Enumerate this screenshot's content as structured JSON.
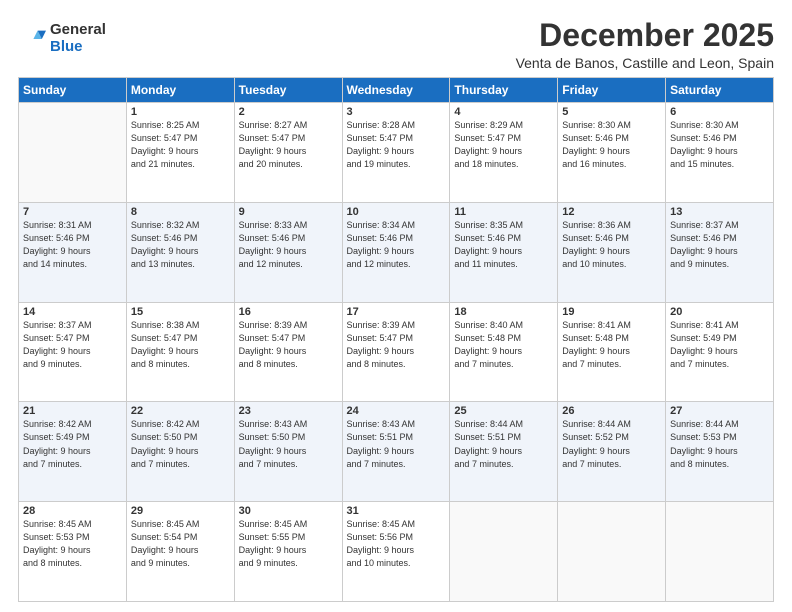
{
  "logo": {
    "general": "General",
    "blue": "Blue"
  },
  "header": {
    "month": "December 2025",
    "location": "Venta de Banos, Castille and Leon, Spain"
  },
  "weekdays": [
    "Sunday",
    "Monday",
    "Tuesday",
    "Wednesday",
    "Thursday",
    "Friday",
    "Saturday"
  ],
  "weeks": [
    [
      {
        "day": "",
        "info": ""
      },
      {
        "day": "1",
        "info": "Sunrise: 8:25 AM\nSunset: 5:47 PM\nDaylight: 9 hours\nand 21 minutes."
      },
      {
        "day": "2",
        "info": "Sunrise: 8:27 AM\nSunset: 5:47 PM\nDaylight: 9 hours\nand 20 minutes."
      },
      {
        "day": "3",
        "info": "Sunrise: 8:28 AM\nSunset: 5:47 PM\nDaylight: 9 hours\nand 19 minutes."
      },
      {
        "day": "4",
        "info": "Sunrise: 8:29 AM\nSunset: 5:47 PM\nDaylight: 9 hours\nand 18 minutes."
      },
      {
        "day": "5",
        "info": "Sunrise: 8:30 AM\nSunset: 5:46 PM\nDaylight: 9 hours\nand 16 minutes."
      },
      {
        "day": "6",
        "info": "Sunrise: 8:30 AM\nSunset: 5:46 PM\nDaylight: 9 hours\nand 15 minutes."
      }
    ],
    [
      {
        "day": "7",
        "info": "Sunrise: 8:31 AM\nSunset: 5:46 PM\nDaylight: 9 hours\nand 14 minutes."
      },
      {
        "day": "8",
        "info": "Sunrise: 8:32 AM\nSunset: 5:46 PM\nDaylight: 9 hours\nand 13 minutes."
      },
      {
        "day": "9",
        "info": "Sunrise: 8:33 AM\nSunset: 5:46 PM\nDaylight: 9 hours\nand 12 minutes."
      },
      {
        "day": "10",
        "info": "Sunrise: 8:34 AM\nSunset: 5:46 PM\nDaylight: 9 hours\nand 12 minutes."
      },
      {
        "day": "11",
        "info": "Sunrise: 8:35 AM\nSunset: 5:46 PM\nDaylight: 9 hours\nand 11 minutes."
      },
      {
        "day": "12",
        "info": "Sunrise: 8:36 AM\nSunset: 5:46 PM\nDaylight: 9 hours\nand 10 minutes."
      },
      {
        "day": "13",
        "info": "Sunrise: 8:37 AM\nSunset: 5:46 PM\nDaylight: 9 hours\nand 9 minutes."
      }
    ],
    [
      {
        "day": "14",
        "info": "Sunrise: 8:37 AM\nSunset: 5:47 PM\nDaylight: 9 hours\nand 9 minutes."
      },
      {
        "day": "15",
        "info": "Sunrise: 8:38 AM\nSunset: 5:47 PM\nDaylight: 9 hours\nand 8 minutes."
      },
      {
        "day": "16",
        "info": "Sunrise: 8:39 AM\nSunset: 5:47 PM\nDaylight: 9 hours\nand 8 minutes."
      },
      {
        "day": "17",
        "info": "Sunrise: 8:39 AM\nSunset: 5:47 PM\nDaylight: 9 hours\nand 8 minutes."
      },
      {
        "day": "18",
        "info": "Sunrise: 8:40 AM\nSunset: 5:48 PM\nDaylight: 9 hours\nand 7 minutes."
      },
      {
        "day": "19",
        "info": "Sunrise: 8:41 AM\nSunset: 5:48 PM\nDaylight: 9 hours\nand 7 minutes."
      },
      {
        "day": "20",
        "info": "Sunrise: 8:41 AM\nSunset: 5:49 PM\nDaylight: 9 hours\nand 7 minutes."
      }
    ],
    [
      {
        "day": "21",
        "info": "Sunrise: 8:42 AM\nSunset: 5:49 PM\nDaylight: 9 hours\nand 7 minutes."
      },
      {
        "day": "22",
        "info": "Sunrise: 8:42 AM\nSunset: 5:50 PM\nDaylight: 9 hours\nand 7 minutes."
      },
      {
        "day": "23",
        "info": "Sunrise: 8:43 AM\nSunset: 5:50 PM\nDaylight: 9 hours\nand 7 minutes."
      },
      {
        "day": "24",
        "info": "Sunrise: 8:43 AM\nSunset: 5:51 PM\nDaylight: 9 hours\nand 7 minutes."
      },
      {
        "day": "25",
        "info": "Sunrise: 8:44 AM\nSunset: 5:51 PM\nDaylight: 9 hours\nand 7 minutes."
      },
      {
        "day": "26",
        "info": "Sunrise: 8:44 AM\nSunset: 5:52 PM\nDaylight: 9 hours\nand 7 minutes."
      },
      {
        "day": "27",
        "info": "Sunrise: 8:44 AM\nSunset: 5:53 PM\nDaylight: 9 hours\nand 8 minutes."
      }
    ],
    [
      {
        "day": "28",
        "info": "Sunrise: 8:45 AM\nSunset: 5:53 PM\nDaylight: 9 hours\nand 8 minutes."
      },
      {
        "day": "29",
        "info": "Sunrise: 8:45 AM\nSunset: 5:54 PM\nDaylight: 9 hours\nand 9 minutes."
      },
      {
        "day": "30",
        "info": "Sunrise: 8:45 AM\nSunset: 5:55 PM\nDaylight: 9 hours\nand 9 minutes."
      },
      {
        "day": "31",
        "info": "Sunrise: 8:45 AM\nSunset: 5:56 PM\nDaylight: 9 hours\nand 10 minutes."
      },
      {
        "day": "",
        "info": ""
      },
      {
        "day": "",
        "info": ""
      },
      {
        "day": "",
        "info": ""
      }
    ]
  ]
}
